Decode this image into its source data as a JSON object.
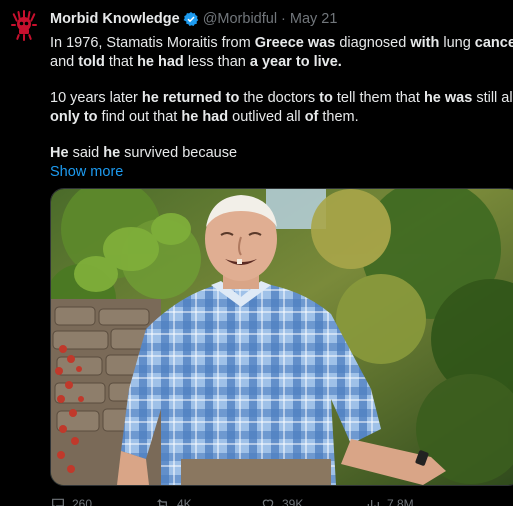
{
  "tweet": {
    "display_name": "Morbid Knowledge",
    "handle": "@Morbidful",
    "separator": "·",
    "date": "May 21",
    "text_lines": [
      [
        {
          "t": "In 1976, Stamatis Moraitis from ",
          "b": false
        },
        {
          "t": "Greece",
          "b": true
        },
        {
          "t": " ",
          "b": false
        },
        {
          "t": "was",
          "b": true
        },
        {
          "t": " diagnosed ",
          "b": false
        },
        {
          "t": "with",
          "b": true
        },
        {
          "t": " lung ",
          "b": false
        },
        {
          "t": "cancer",
          "b": true
        }
      ],
      [
        {
          "t": "and ",
          "b": false
        },
        {
          "t": "told",
          "b": true
        },
        {
          "t": " that ",
          "b": false
        },
        {
          "t": "he had",
          "b": true
        },
        {
          "t": " less than ",
          "b": false
        },
        {
          "t": "a year",
          "b": true
        },
        {
          "t": " ",
          "b": false
        },
        {
          "t": "to live.",
          "b": true
        }
      ],
      [],
      [
        {
          "t": "10 years later ",
          "b": false
        },
        {
          "t": "he returned to",
          "b": true
        },
        {
          "t": " the doctors ",
          "b": false
        },
        {
          "t": "to",
          "b": true
        },
        {
          "t": " tell them that ",
          "b": false
        },
        {
          "t": "he was",
          "b": true
        },
        {
          "t": " still alive,",
          "b": false
        }
      ],
      [
        {
          "t": "only",
          "b": true
        },
        {
          "t": " ",
          "b": false
        },
        {
          "t": "to",
          "b": true
        },
        {
          "t": " find out that ",
          "b": false
        },
        {
          "t": "he had",
          "b": true
        },
        {
          "t": " outlived all ",
          "b": false
        },
        {
          "t": "of",
          "b": true
        },
        {
          "t": " them.",
          "b": false
        }
      ],
      [],
      [
        {
          "t": "He",
          "b": true
        },
        {
          "t": " said ",
          "b": false
        },
        {
          "t": "he",
          "b": true
        },
        {
          "t": " survived because",
          "b": false
        }
      ]
    ],
    "show_more": "Show more"
  },
  "actions": [
    {
      "name": "reply",
      "count": "260",
      "icon": "reply-icon"
    },
    {
      "name": "retweet",
      "count": "4K",
      "icon": "retweet-icon"
    },
    {
      "name": "like",
      "count": "39K",
      "icon": "heart-icon"
    },
    {
      "name": "views",
      "count": "7.8M",
      "icon": "views-icon"
    }
  ],
  "colors": {
    "background": "#000000",
    "text": "#e7e9ea",
    "muted": "#71767b",
    "link": "#1d9bf0",
    "verified": "#1d9bf0",
    "avatar_mark": "#c8102e"
  }
}
